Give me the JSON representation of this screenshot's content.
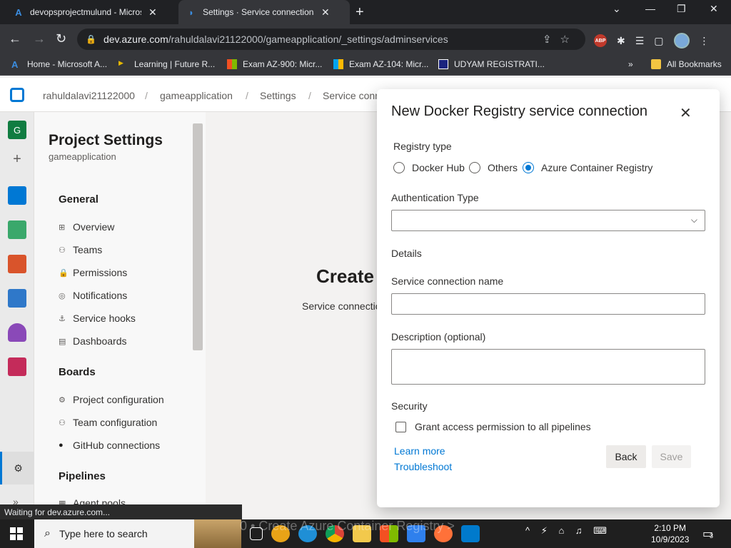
{
  "browser": {
    "tabs": [
      {
        "title": "devopsprojectmulund - Microso",
        "favicon": "azure-devops-logo",
        "close": "✕"
      },
      {
        "title": "Settings · Service connections (g",
        "favicon": "azure-devops-logo",
        "close": "✕"
      }
    ],
    "new_tab": "+",
    "window_controls": {
      "chevron": "⌄",
      "minimize": "—",
      "restore": "❐",
      "close": "✕"
    },
    "url": {
      "host": "dev.azure.com",
      "path": "/rahuldalavi21122000/gameapplication/_settings/adminservices"
    },
    "abp_label": "ABP",
    "bookmarks": [
      {
        "label": "Home - Microsoft A..."
      },
      {
        "label": "Learning | Future R..."
      },
      {
        "label": "Exam AZ-900: Micr..."
      },
      {
        "label": "Exam AZ-104: Micr..."
      },
      {
        "label": "UDYAM REGISTRATI..."
      },
      {
        "label": "All Bookmarks"
      }
    ],
    "bookmarks_more": "»",
    "status": "Waiting for dev.azure.com..."
  },
  "header": {
    "breadcrumbs": [
      "rahuldalavi21122000",
      "gameapplication",
      "Settings",
      "Service conn"
    ],
    "separator": "/"
  },
  "rail": {
    "org_initial": "G",
    "add": "+",
    "collapse": "»"
  },
  "settings": {
    "title": "Project Settings",
    "subtitle": "gameapplication",
    "sections": [
      {
        "label": "General",
        "items": [
          {
            "label": "Overview",
            "icon": "⊞"
          },
          {
            "label": "Teams",
            "icon": "⚇"
          },
          {
            "label": "Permissions",
            "icon": "🔒"
          },
          {
            "label": "Notifications",
            "icon": "◎"
          },
          {
            "label": "Service hooks",
            "icon": "⚓"
          },
          {
            "label": "Dashboards",
            "icon": "▤"
          }
        ]
      },
      {
        "label": "Boards",
        "items": [
          {
            "label": "Project configuration",
            "icon": "⚙"
          },
          {
            "label": "Team configuration",
            "icon": "⚇"
          },
          {
            "label": "GitHub connections",
            "icon": "●"
          }
        ]
      },
      {
        "label": "Pipelines",
        "items": [
          {
            "label": "Agent pools",
            "icon": "▦"
          }
        ]
      }
    ]
  },
  "main": {
    "title": "Create",
    "description": "Service connectio"
  },
  "dialog": {
    "title": "New Docker Registry service connection",
    "close": "✕",
    "registry_type_label": "Registry type",
    "registry_options": [
      {
        "label": "Docker Hub",
        "selected": false
      },
      {
        "label": "Others",
        "selected": false
      },
      {
        "label": "Azure Container Registry",
        "selected": true
      }
    ],
    "auth_type_label": "Authentication Type",
    "auth_type_value": "",
    "details_label": "Details",
    "name_label": "Service connection name",
    "name_value": "",
    "description_label": "Description (optional)",
    "description_value": "",
    "security_label": "Security",
    "grant_access_label": "Grant access permission to all pipelines",
    "grant_access_checked": false,
    "learn_more": "Learn more",
    "troubleshoot": "Troubleshoot",
    "back_button": "Back",
    "save_button": "Save",
    "chevron": "⌵"
  },
  "taskbar": {
    "search_placeholder": "Type here to search",
    "search_glyph": "⌕",
    "ghost_text": "0 • Create Azure Container Registry >",
    "time": "2:10 PM",
    "date": "10/9/2023",
    "notification_count": "3"
  },
  "colors": {
    "accent": "#0078d4",
    "chrome_dark": "#202124",
    "taskbar": "#1f1f1f"
  }
}
